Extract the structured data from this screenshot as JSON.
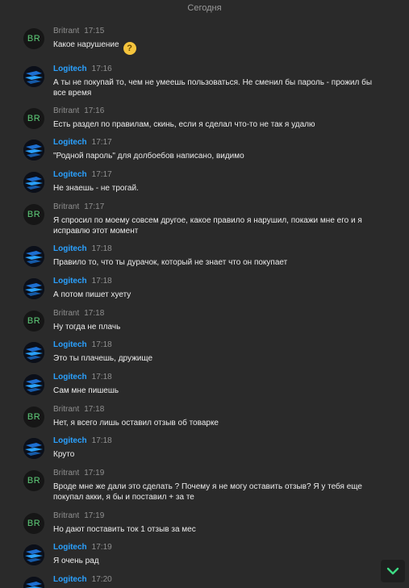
{
  "chat": {
    "date_divider": "Сегодня",
    "messages": [
      {
        "author": "Britrant",
        "time": "17:15",
        "text": "Какое нарушение",
        "avatar_text": "BR",
        "emoji": "thinking-face"
      },
      {
        "author": "Logitech",
        "time": "17:16",
        "text": "А ты не покупай то, чем не умеешь пользоваться. Не сменил бы пароль - прожил бы все время"
      },
      {
        "author": "Britrant",
        "time": "17:16",
        "text": "Есть раздел по правилам, скинь, если я сделал что-то не так я удалю",
        "avatar_text": "BR"
      },
      {
        "author": "Logitech",
        "time": "17:17",
        "text": "\"Родной пароль\" для долбоебов написано, видимо"
      },
      {
        "author": "Logitech",
        "time": "17:17",
        "text": "Не знаешь - не трогай."
      },
      {
        "author": "Britrant",
        "time": "17:17",
        "text": "Я спросил по моему совсем другое, какое правило я нарушил, покажи мне его и я исправлю этот момент",
        "avatar_text": "BR"
      },
      {
        "author": "Logitech",
        "time": "17:18",
        "text": "Правило то, что ты дурачок, который не знает что он покупает"
      },
      {
        "author": "Logitech",
        "time": "17:18",
        "text": "А потом пишет хуету"
      },
      {
        "author": "Britrant",
        "time": "17:18",
        "text": "Ну тогда не плачь",
        "avatar_text": "BR"
      },
      {
        "author": "Logitech",
        "time": "17:18",
        "text": "Это ты плачешь, дружище"
      },
      {
        "author": "Logitech",
        "time": "17:18",
        "text": "Сам мне пишешь"
      },
      {
        "author": "Britrant",
        "time": "17:18",
        "text": "Нет, я всего лишь оставил отзыв об товарке",
        "avatar_text": "BR"
      },
      {
        "author": "Logitech",
        "time": "17:18",
        "text": "Круто"
      },
      {
        "author": "Britrant",
        "time": "17:19",
        "text": "Вроде мне же дали это сделать ? Почему я не могу оставить отзыв? Я у тебя еще покупал акки, я бы и поставил + за те",
        "avatar_text": "BR"
      },
      {
        "author": "Britrant",
        "time": "17:19",
        "text": "Но дают поставить ток 1 отзыв за мес",
        "avatar_text": "BR"
      },
      {
        "author": "Logitech",
        "time": "17:19",
        "text": "Я очень рад"
      },
      {
        "author": "Logitech",
        "time": "17:20",
        "text": ""
      }
    ]
  },
  "colors": {
    "background": "#2a2a2a",
    "logitech_name": "#2aa1ff",
    "britrant_name": "#8f8f8f",
    "britrant_avatar_text": "#5fcf7a",
    "scroll_button_arrow": "#3ddc84"
  },
  "icons": {
    "scroll_down": "chevron-down-icon",
    "emoji": "thinking-face-emoji"
  }
}
